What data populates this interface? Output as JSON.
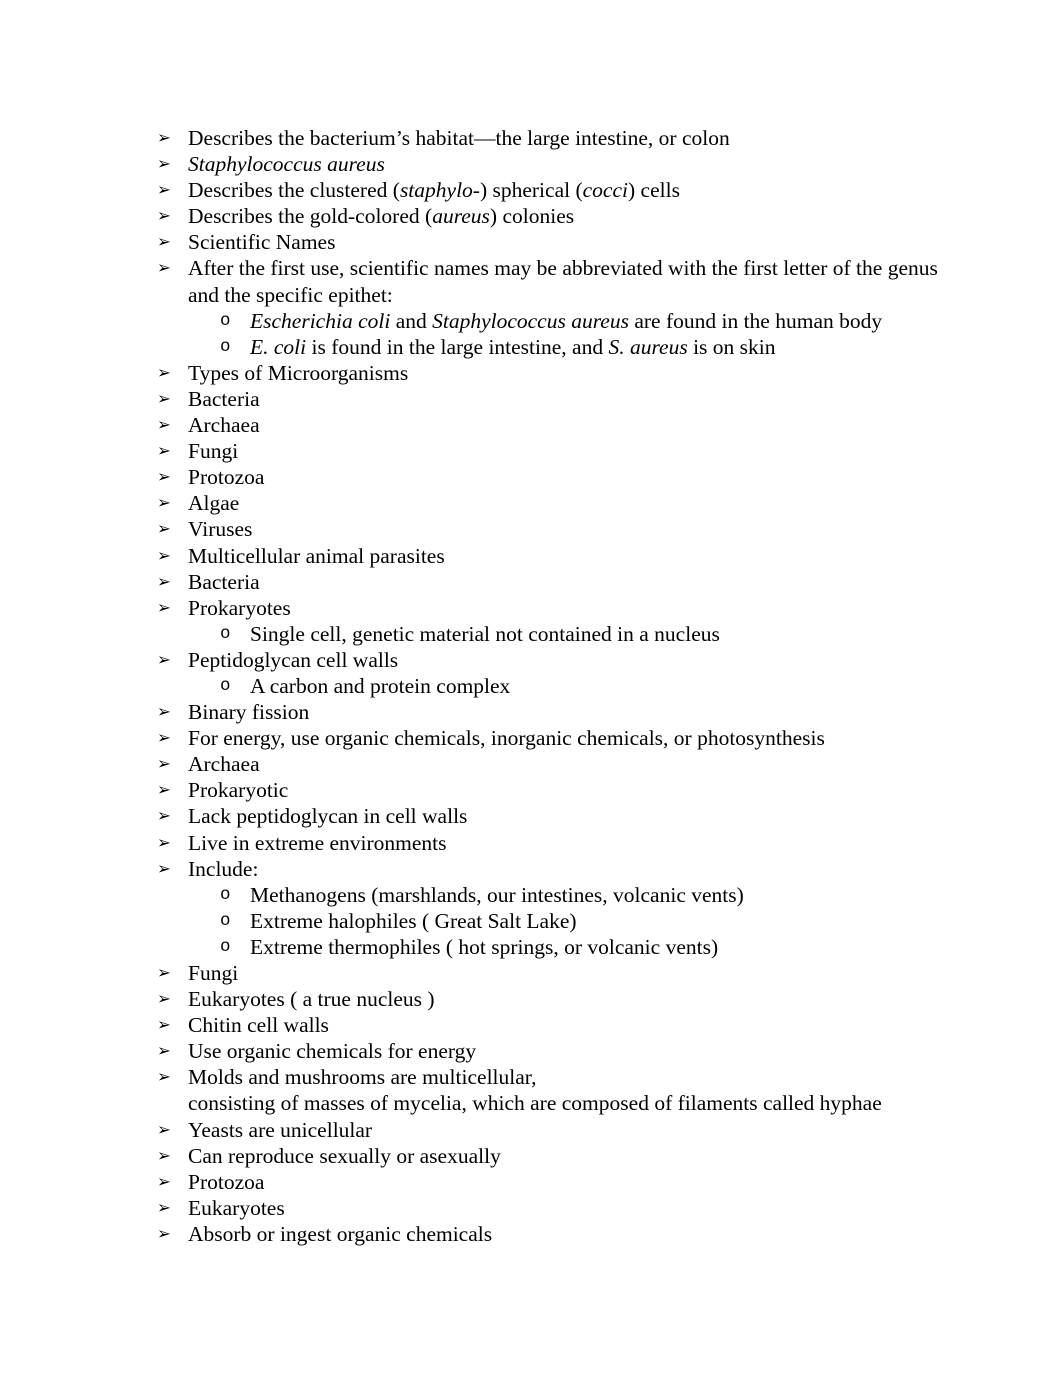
{
  "document": {
    "background_color": "#ffffff",
    "text_color": "#000000",
    "bullet_level1_glyph": "➢",
    "bullet_level2_glyph": "o"
  },
  "outline": [
    {
      "level": 1,
      "id": "habitat-colon",
      "text": "Describes the bacterium’s habitat—the large intestine, or colon",
      "html": "Describes the bacterium’s habitat—the large intestine, or colon"
    },
    {
      "level": 1,
      "id": "staphylococcus-aureus",
      "text": "Staphylococcus aureus",
      "html": "<i>Staphylococcus aureus</i>"
    },
    {
      "level": 1,
      "id": "clustered-cocci-cells",
      "text": "Describes the clustered (staphylo-) spherical (cocci) cells",
      "html": "Describes the clustered (<i>staphylo</i>-) spherical (<i>cocci</i>) cells"
    },
    {
      "level": 1,
      "id": "gold-colored-colonies",
      "text": "Describes the gold-colored (aureus) colonies",
      "html": "Describes the gold-colored (<i>aureus</i>) colonies"
    },
    {
      "level": 1,
      "id": "scientific-names",
      "text": "Scientific Names",
      "html": "Scientific Names"
    },
    {
      "level": 1,
      "id": "abbreviation-rule",
      "text": "After the first use, scientific names may be abbreviated with the first letter of the genus and the specific epithet:",
      "html": "After the first use, scientific names may be abbreviated with the first letter of the genus and the specific epithet:"
    },
    {
      "level": 2,
      "id": "ecoli-saureus-human-body",
      "text": "Escherichia coli and Staphylococcus aureus are found in the human body",
      "html": "<i>Escherichia coli</i> and <i>Staphylococcus aureus</i> are found in the human body"
    },
    {
      "level": 2,
      "id": "ecoli-intestine-saureus-skin",
      "text": "E. coli is found in the large intestine, and S. aureus is on skin",
      "html": "<i>E. coli</i> is found in the large intestine, and <i>S. aureus</i> is on skin"
    },
    {
      "level": 1,
      "id": "types-of-microorganisms",
      "text": "Types of Microorganisms",
      "html": "Types of Microorganisms"
    },
    {
      "level": 1,
      "id": "bacteria-1",
      "text": "Bacteria",
      "html": "Bacteria"
    },
    {
      "level": 1,
      "id": "archaea-1",
      "text": "Archaea",
      "html": "Archaea"
    },
    {
      "level": 1,
      "id": "fungi-1",
      "text": "Fungi",
      "html": "Fungi"
    },
    {
      "level": 1,
      "id": "protozoa-1",
      "text": "Protozoa",
      "html": "Protozoa"
    },
    {
      "level": 1,
      "id": "algae",
      "text": "Algae",
      "html": "Algae"
    },
    {
      "level": 1,
      "id": "viruses",
      "text": "Viruses",
      "html": "Viruses"
    },
    {
      "level": 1,
      "id": "multicellular-animal-parasites",
      "text": "Multicellular animal parasites",
      "html": "Multicellular animal parasites"
    },
    {
      "level": 1,
      "id": "bacteria-2",
      "text": "Bacteria",
      "html": "Bacteria"
    },
    {
      "level": 1,
      "id": "prokaryotes",
      "text": "Prokaryotes",
      "html": "Prokaryotes"
    },
    {
      "level": 2,
      "id": "single-cell-no-nucleus",
      "text": "Single cell, genetic material not contained in a nucleus",
      "html": "Single cell, genetic material not contained in a nucleus"
    },
    {
      "level": 1,
      "id": "peptidoglycan-cell-walls",
      "text": "Peptidoglycan cell walls",
      "html": "Peptidoglycan cell walls"
    },
    {
      "level": 2,
      "id": "carbon-protein-complex",
      "text": "A carbon and protein complex",
      "html": "A carbon and protein complex"
    },
    {
      "level": 1,
      "id": "binary-fission",
      "text": "Binary fission",
      "html": "Binary fission"
    },
    {
      "level": 1,
      "id": "energy-sources",
      "text": "For energy, use organic chemicals, inorganic chemicals, or photosynthesis",
      "html": "For energy, use organic chemicals, inorganic chemicals, or photosynthesis"
    },
    {
      "level": 1,
      "id": "archaea-2",
      "text": "Archaea",
      "html": "Archaea"
    },
    {
      "level": 1,
      "id": "prokaryotic",
      "text": "Prokaryotic",
      "html": "Prokaryotic"
    },
    {
      "level": 1,
      "id": "lack-peptidoglycan",
      "text": "Lack peptidoglycan in cell walls",
      "html": "Lack peptidoglycan in cell walls"
    },
    {
      "level": 1,
      "id": "live-extreme-environments",
      "text": "Live in extreme environments",
      "html": "Live in extreme environments"
    },
    {
      "level": 1,
      "id": "include",
      "text": "Include:",
      "html": "Include:"
    },
    {
      "level": 2,
      "id": "methanogens",
      "text": "Methanogens (marshlands, our intestines, volcanic vents)",
      "html": "Methanogens (marshlands, our intestines, volcanic vents)"
    },
    {
      "level": 2,
      "id": "extreme-halophiles",
      "text": "Extreme halophiles ( Great Salt Lake)",
      "html": "Extreme halophiles ( Great Salt Lake)"
    },
    {
      "level": 2,
      "id": "extreme-thermophiles",
      "text": "Extreme thermophiles ( hot springs, or volcanic vents)",
      "html": "Extreme thermophiles ( hot springs, or volcanic vents)"
    },
    {
      "level": 1,
      "id": "fungi-2",
      "text": "Fungi",
      "html": "Fungi"
    },
    {
      "level": 1,
      "id": "eukaryotes-true-nucleus",
      "text": "Eukaryotes ( a true nucleus )",
      "html": "Eukaryotes ( a true nucleus )"
    },
    {
      "level": 1,
      "id": "chitin-cell-walls",
      "text": "Chitin cell walls",
      "html": "Chitin cell walls"
    },
    {
      "level": 1,
      "id": "use-organic-chemicals-energy",
      "text": "Use organic chemicals for energy",
      "html": "Use organic chemicals for energy"
    },
    {
      "level": 1,
      "id": "molds-mushrooms-multicellular",
      "text": "Molds and mushrooms are multicellular, consisting of masses of mycelia, which are composed of filaments called hyphae",
      "html": "Molds and mushrooms are multicellular,<br>consisting of masses of mycelia, which are composed of filaments called hyphae"
    },
    {
      "level": 1,
      "id": "yeasts-unicellular",
      "text": "Yeasts are unicellular",
      "html": "Yeasts are unicellular"
    },
    {
      "level": 1,
      "id": "reproduce-sexually-asexually",
      "text": "Can reproduce sexually or asexually",
      "html": "Can reproduce sexually or asexually"
    },
    {
      "level": 1,
      "id": "protozoa-2",
      "text": "Protozoa",
      "html": "Protozoa"
    },
    {
      "level": 1,
      "id": "eukaryotes-2",
      "text": "Eukaryotes",
      "html": "Eukaryotes"
    },
    {
      "level": 1,
      "id": "absorb-ingest-organic-chemicals",
      "text": "Absorb or ingest organic chemicals",
      "html": "Absorb or ingest organic chemicals"
    }
  ]
}
